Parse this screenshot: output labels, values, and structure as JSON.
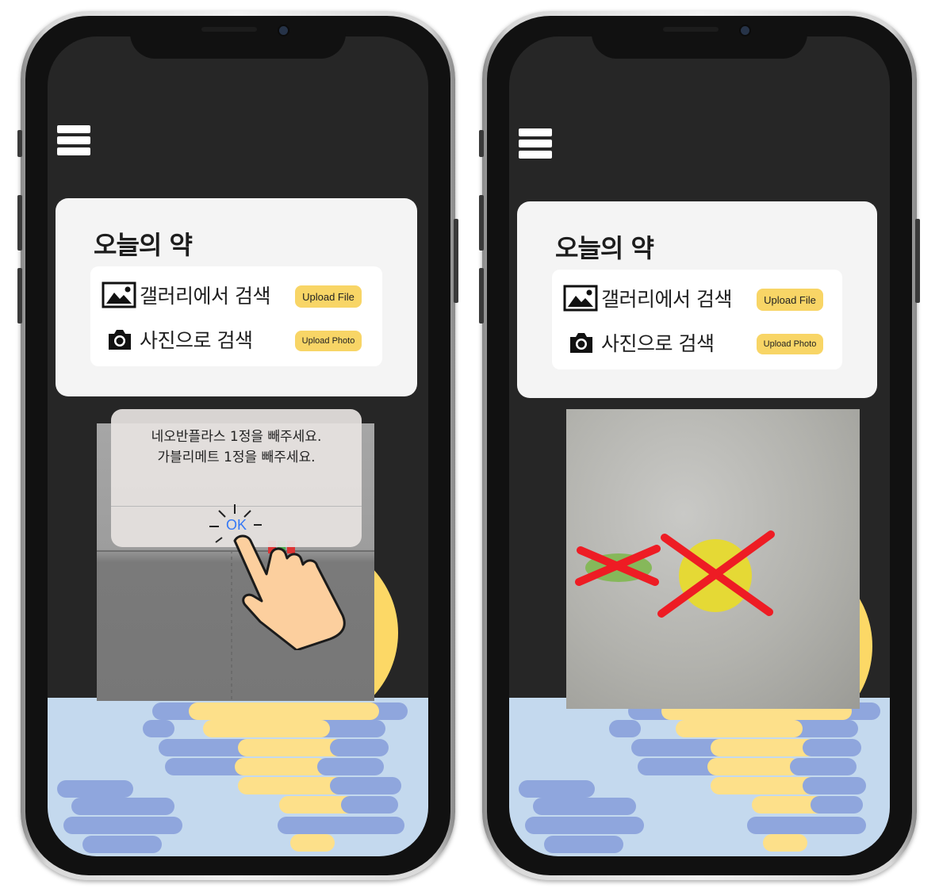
{
  "screens": [
    {
      "app_title": "오늘의 약",
      "gallery_label": "갤러리에서 검색",
      "upload_file_button": "Upload File",
      "camera_label": "사진으로 검색",
      "upload_photo_button": "Upload Photo",
      "dialog": {
        "line1": "네오반플라스 1정을 빼주세요.",
        "line2": "가블리메트 1정을 빼주세요.",
        "ok_button": "OK"
      }
    },
    {
      "app_title": "오늘의 약",
      "gallery_label": "갤러리에서 검색",
      "upload_file_button": "Upload File",
      "camera_label": "사진으로 검색",
      "upload_photo_button": "Upload Photo"
    }
  ],
  "icons": [
    "menu-icon",
    "image-icon",
    "camera-icon",
    "tap-hand-icon",
    "remove-x-icon"
  ],
  "colors": {
    "background_dark": "#262626",
    "card": "#f4f4f4",
    "accent_yellow": "#f8d566",
    "sun": "#fcd866",
    "sea": "#c4d9ee",
    "wave_blue": "#8fa6dd",
    "ok_blue": "#3478f6",
    "cross_red": "#ee1c24"
  }
}
